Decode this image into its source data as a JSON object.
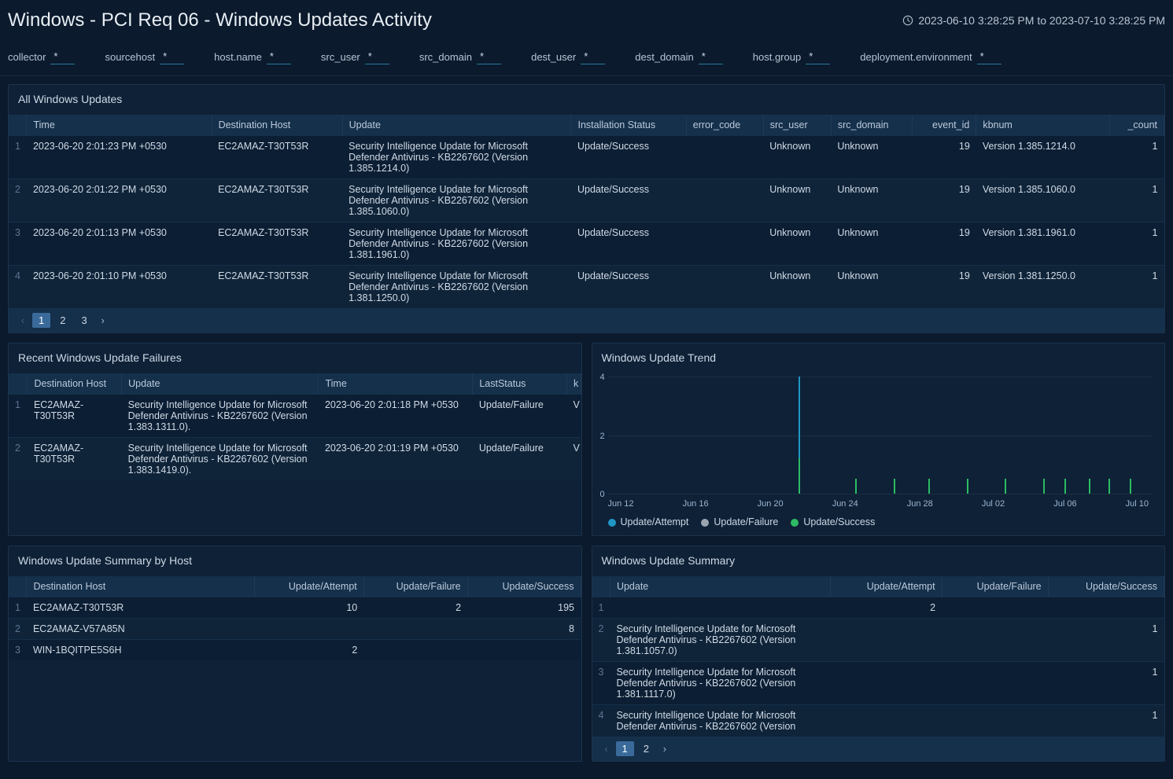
{
  "header": {
    "title": "Windows - PCI Req 06 - Windows Updates Activity",
    "time_range": "2023-06-10 3:28:25 PM to 2023-07-10 3:28:25 PM"
  },
  "filters": [
    {
      "label": "collector",
      "value": "*"
    },
    {
      "label": "sourcehost",
      "value": "*"
    },
    {
      "label": "host.name",
      "value": "*"
    },
    {
      "label": "src_user",
      "value": "*"
    },
    {
      "label": "src_domain",
      "value": "*"
    },
    {
      "label": "dest_user",
      "value": "*"
    },
    {
      "label": "dest_domain",
      "value": "*"
    },
    {
      "label": "host.group",
      "value": "*"
    },
    {
      "label": "deployment.environment",
      "value": "*"
    }
  ],
  "all_updates": {
    "title": "All Windows Updates",
    "columns": [
      "",
      "Time",
      "Destination Host",
      "Update",
      "Installation Status",
      "error_code",
      "src_user",
      "src_domain",
      "event_id",
      "kbnum",
      "_count"
    ],
    "rows": [
      {
        "idx": "1",
        "time": "2023-06-20 2:01:23 PM +0530",
        "host": "EC2AMAZ-T30T53R",
        "update": "Security Intelligence Update for Microsoft Defender Antivirus - KB2267602 (Version 1.385.1214.0)",
        "status": "Update/Success",
        "error": "",
        "src_user": "Unknown",
        "src_domain": "Unknown",
        "event_id": "19",
        "kbnum": "Version 1.385.1214.0",
        "count": "1"
      },
      {
        "idx": "2",
        "time": "2023-06-20 2:01:22 PM +0530",
        "host": "EC2AMAZ-T30T53R",
        "update": "Security Intelligence Update for Microsoft Defender Antivirus - KB2267602 (Version 1.385.1060.0)",
        "status": "Update/Success",
        "error": "",
        "src_user": "Unknown",
        "src_domain": "Unknown",
        "event_id": "19",
        "kbnum": "Version 1.385.1060.0",
        "count": "1"
      },
      {
        "idx": "3",
        "time": "2023-06-20 2:01:13 PM +0530",
        "host": "EC2AMAZ-T30T53R",
        "update": "Security Intelligence Update for Microsoft Defender Antivirus - KB2267602 (Version 1.381.1961.0)",
        "status": "Update/Success",
        "error": "",
        "src_user": "Unknown",
        "src_domain": "Unknown",
        "event_id": "19",
        "kbnum": "Version 1.381.1961.0",
        "count": "1"
      },
      {
        "idx": "4",
        "time": "2023-06-20 2:01:10 PM +0530",
        "host": "EC2AMAZ-T30T53R",
        "update": "Security Intelligence Update for Microsoft Defender Antivirus - KB2267602 (Version 1.381.1250.0)",
        "status": "Update/Success",
        "error": "",
        "src_user": "Unknown",
        "src_domain": "Unknown",
        "event_id": "19",
        "kbnum": "Version 1.381.1250.0",
        "count": "1"
      }
    ],
    "pages": [
      "1",
      "2",
      "3"
    ]
  },
  "failures": {
    "title": "Recent Windows Update Failures",
    "columns": [
      "",
      "Destination Host",
      "Update",
      "Time",
      "LastStatus",
      "k"
    ],
    "rows": [
      {
        "idx": "1",
        "host": "EC2AMAZ-T30T53R",
        "update": "Security Intelligence Update for Microsoft Defender Antivirus - KB2267602 (Version 1.383.1311.0).",
        "time": "2023-06-20 2:01:18 PM +0530",
        "status": "Update/Failure",
        "k": "V"
      },
      {
        "idx": "2",
        "host": "EC2AMAZ-T30T53R",
        "update": "Security Intelligence Update for Microsoft Defender Antivirus - KB2267602 (Version 1.383.1419.0).",
        "time": "2023-06-20 2:01:19 PM +0530",
        "status": "Update/Failure",
        "k": "V"
      }
    ]
  },
  "trend": {
    "title": "Windows Update Trend",
    "legend": {
      "attempt": "Update/Attempt",
      "failure": "Update/Failure",
      "success": "Update/Success"
    }
  },
  "summary_host": {
    "title": "Windows Update Summary by Host",
    "columns": [
      "",
      "Destination Host",
      "Update/Attempt",
      "Update/Failure",
      "Update/Success"
    ],
    "rows": [
      {
        "idx": "1",
        "host": "EC2AMAZ-T30T53R",
        "attempt": "10",
        "failure": "2",
        "success": "195"
      },
      {
        "idx": "2",
        "host": "EC2AMAZ-V57A85N",
        "attempt": "",
        "failure": "",
        "success": "8"
      },
      {
        "idx": "3",
        "host": "WIN-1BQITPE5S6H",
        "attempt": "2",
        "failure": "",
        "success": ""
      }
    ]
  },
  "summary": {
    "title": "Windows Update Summary",
    "columns": [
      "",
      "Update",
      "Update/Attempt",
      "Update/Failure",
      "Update/Success"
    ],
    "rows": [
      {
        "idx": "1",
        "update": "",
        "attempt": "2",
        "failure": "",
        "success": ""
      },
      {
        "idx": "2",
        "update": "Security Intelligence Update for Microsoft Defender Antivirus - KB2267602 (Version 1.381.1057.0)",
        "attempt": "",
        "failure": "",
        "success": "1"
      },
      {
        "idx": "3",
        "update": "Security Intelligence Update for Microsoft Defender Antivirus - KB2267602 (Version 1.381.1117.0)",
        "attempt": "",
        "failure": "",
        "success": "1"
      },
      {
        "idx": "4",
        "update": "Security Intelligence Update for Microsoft Defender Antivirus - KB2267602 (Version",
        "attempt": "",
        "failure": "",
        "success": "1"
      }
    ],
    "pages": [
      "1",
      "2"
    ]
  },
  "chart_data": {
    "type": "bar",
    "title": "Windows Update Trend",
    "xlabel": "",
    "ylabel": "",
    "ylim": [
      0,
      4
    ],
    "y_ticks": [
      0,
      2,
      4
    ],
    "categories": [
      "Jun 12",
      "Jun 16",
      "Jun 20",
      "Jun 24",
      "Jun 28",
      "Jul 02",
      "Jul 06",
      "Jul 10"
    ],
    "series": [
      {
        "name": "Update/Attempt",
        "color": "#2196c5"
      },
      {
        "name": "Update/Failure",
        "color": "#9aa5b1"
      },
      {
        "name": "Update/Success",
        "color": "#2dbb63"
      }
    ],
    "bars": [
      {
        "x_pct": 35.0,
        "type": "attempt",
        "value": 4
      },
      {
        "x_pct": 35.0,
        "type": "failure",
        "value": 0.5
      },
      {
        "x_pct": 35.0,
        "type": "success",
        "value": 1.2
      },
      {
        "x_pct": 45.5,
        "type": "success",
        "value": 0.5
      },
      {
        "x_pct": 52.5,
        "type": "success",
        "value": 0.5
      },
      {
        "x_pct": 59.0,
        "type": "success",
        "value": 0.5
      },
      {
        "x_pct": 66.0,
        "type": "success",
        "value": 0.5
      },
      {
        "x_pct": 73.0,
        "type": "success",
        "value": 0.5
      },
      {
        "x_pct": 80.0,
        "type": "success",
        "value": 0.5
      },
      {
        "x_pct": 84.0,
        "type": "success",
        "value": 0.5
      },
      {
        "x_pct": 88.5,
        "type": "success",
        "value": 0.5
      },
      {
        "x_pct": 92.0,
        "type": "success",
        "value": 0.5
      },
      {
        "x_pct": 96.0,
        "type": "success",
        "value": 0.5
      }
    ]
  }
}
